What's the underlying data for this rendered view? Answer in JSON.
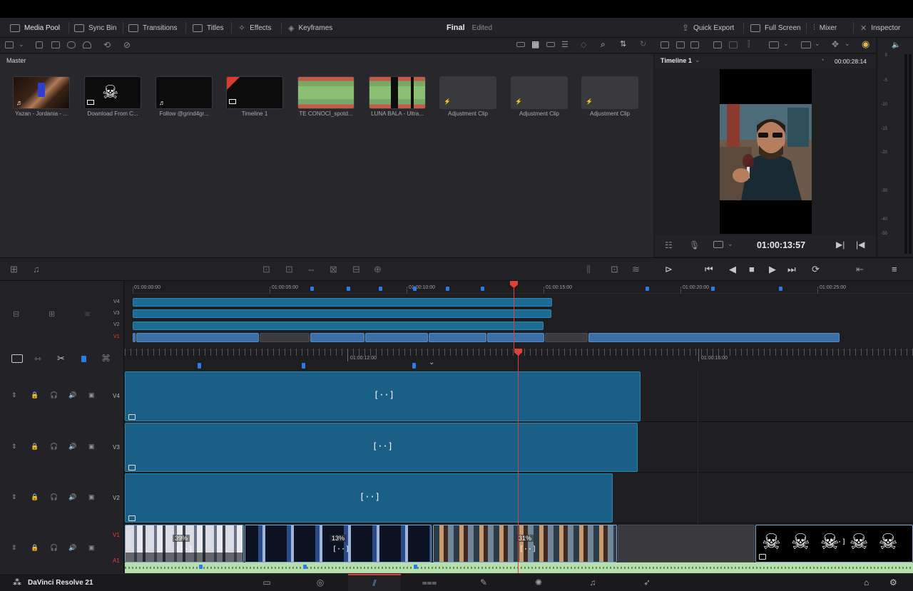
{
  "menubar": {
    "left": [
      {
        "label": "Media Pool",
        "icon": "media-pool-icon"
      },
      {
        "label": "Sync Bin",
        "icon": "sync-bin-icon"
      },
      {
        "label": "Transitions",
        "icon": "transitions-icon"
      },
      {
        "label": "Titles",
        "icon": "titles-icon"
      },
      {
        "label": "Effects",
        "icon": "effects-icon"
      },
      {
        "label": "Keyframes",
        "icon": "keyframes-icon"
      }
    ],
    "project_name": "Final",
    "project_status": "Edited",
    "right": [
      {
        "label": "Quick Export",
        "icon": "export-icon"
      },
      {
        "label": "Full Screen",
        "icon": "fullscreen-icon"
      },
      {
        "label": "Mixer",
        "icon": "mixer-icon"
      },
      {
        "label": "Inspector",
        "icon": "inspector-icon"
      }
    ]
  },
  "media_pool": {
    "bin": "Master",
    "items": [
      {
        "label": "Yazan - Jordania - ...",
        "kind": "audio"
      },
      {
        "label": "Download From C...",
        "kind": "image"
      },
      {
        "label": "Follow @grind4gr...",
        "kind": "audio"
      },
      {
        "label": "Timeline 1",
        "kind": "timeline"
      },
      {
        "label": "TE CONOCÍ_spotd...",
        "kind": "audio-wave"
      },
      {
        "label": "LUNA BALA - Ultra...",
        "kind": "audio-wave"
      },
      {
        "label": "Adjustment Clip",
        "kind": "adjustment"
      },
      {
        "label": "Adjustment Clip",
        "kind": "adjustment"
      },
      {
        "label": "Adjustment Clip",
        "kind": "adjustment"
      }
    ]
  },
  "viewer": {
    "timeline_name": "Timeline 1",
    "duration": "00:00:28:14",
    "timecode": "01:00:13:57"
  },
  "meter_scale": [
    "0",
    "-5",
    "-10",
    "-15",
    "-20",
    "-30",
    "-40",
    "-50"
  ],
  "mini_timeline": {
    "ruler": [
      "01:00:00:00",
      "01:00:05:00",
      "01:00:10:00",
      "01:00:15:00",
      "01:00:20:00",
      "01:00:25:00"
    ],
    "tracks": [
      "V4",
      "V3",
      "V2",
      "V1"
    ]
  },
  "main_timeline": {
    "ruler": [
      "01:00:12:00",
      "01:00:16:00"
    ],
    "tracks": [
      {
        "label": "V4"
      },
      {
        "label": "V3"
      },
      {
        "label": "V2"
      },
      {
        "label": "V1",
        "audio_label": "A1"
      }
    ],
    "speed_badges": [
      "39%",
      "13%",
      "31%"
    ]
  },
  "bottom": {
    "app_name": "DaVinci Resolve 21",
    "pages": [
      "media-page-icon",
      "cut-page-icon",
      "edit-page-icon",
      "fusion-page-icon",
      "color-page-icon",
      "fairlight-page-icon",
      "deliver-page-icon"
    ],
    "active_page": 2
  },
  "colors": {
    "accent": "#e0403a",
    "clip": "#1a5f85",
    "marker": "#2b7be4"
  }
}
